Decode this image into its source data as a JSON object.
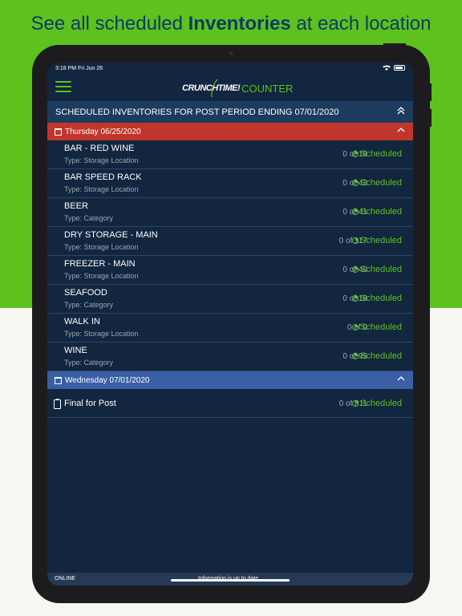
{
  "headline": {
    "prefix": "See all scheduled ",
    "bold": "Inventories",
    "suffix": " at each location"
  },
  "status_bar": {
    "time": "3:18 PM   Fri Jun 26"
  },
  "app": {
    "logo_primary": "CRUNCHTIME!",
    "logo_secondary": "COUNTER"
  },
  "schedule_header": "SCHEDULED INVENTORIES FOR POST PERIOD ENDING 07/01/2020",
  "groups": [
    {
      "date": "Thursday 06/25/2020",
      "color": "#c0362c",
      "items": [
        {
          "name": "BAR - RED WINE",
          "type": "Type: Storage Location",
          "count": "0 of 18",
          "status": "Scheduled"
        },
        {
          "name": "BAR SPEED RACK",
          "type": "Type: Storage Location",
          "count": "0 of 42",
          "status": "Scheduled"
        },
        {
          "name": "BEER",
          "type": "Type: Category",
          "count": "0 of 41",
          "status": "Scheduled"
        },
        {
          "name": "DRY STORAGE - MAIN",
          "type": "Type: Storage Location",
          "count": "0 of 117",
          "status": "Scheduled"
        },
        {
          "name": "FREEZER - MAIN",
          "type": "Type: Storage Location",
          "count": "0 of 40",
          "status": "Scheduled"
        },
        {
          "name": "SEAFOOD",
          "type": "Type: Category",
          "count": "0 of 18",
          "status": "Scheduled"
        },
        {
          "name": "WALK IN",
          "type": "Type: Storage Location",
          "count": "0 of 0",
          "status": "Scheduled"
        },
        {
          "name": "WINE",
          "type": "Type: Category",
          "count": "0 of 95",
          "status": "Scheduled"
        }
      ]
    },
    {
      "date": "Wednesday 07/01/2020",
      "color": "#3a5fa4",
      "items": [
        {
          "name": "Final for Post",
          "count": "0 of 811",
          "status": "Scheduled"
        }
      ]
    }
  ],
  "bottom_bar": {
    "connection": "ONLINE",
    "info": "Information is up to date"
  },
  "colors": {
    "accent": "#5dc11e",
    "background": "#12263f",
    "brand_text": "#0f3a66"
  }
}
